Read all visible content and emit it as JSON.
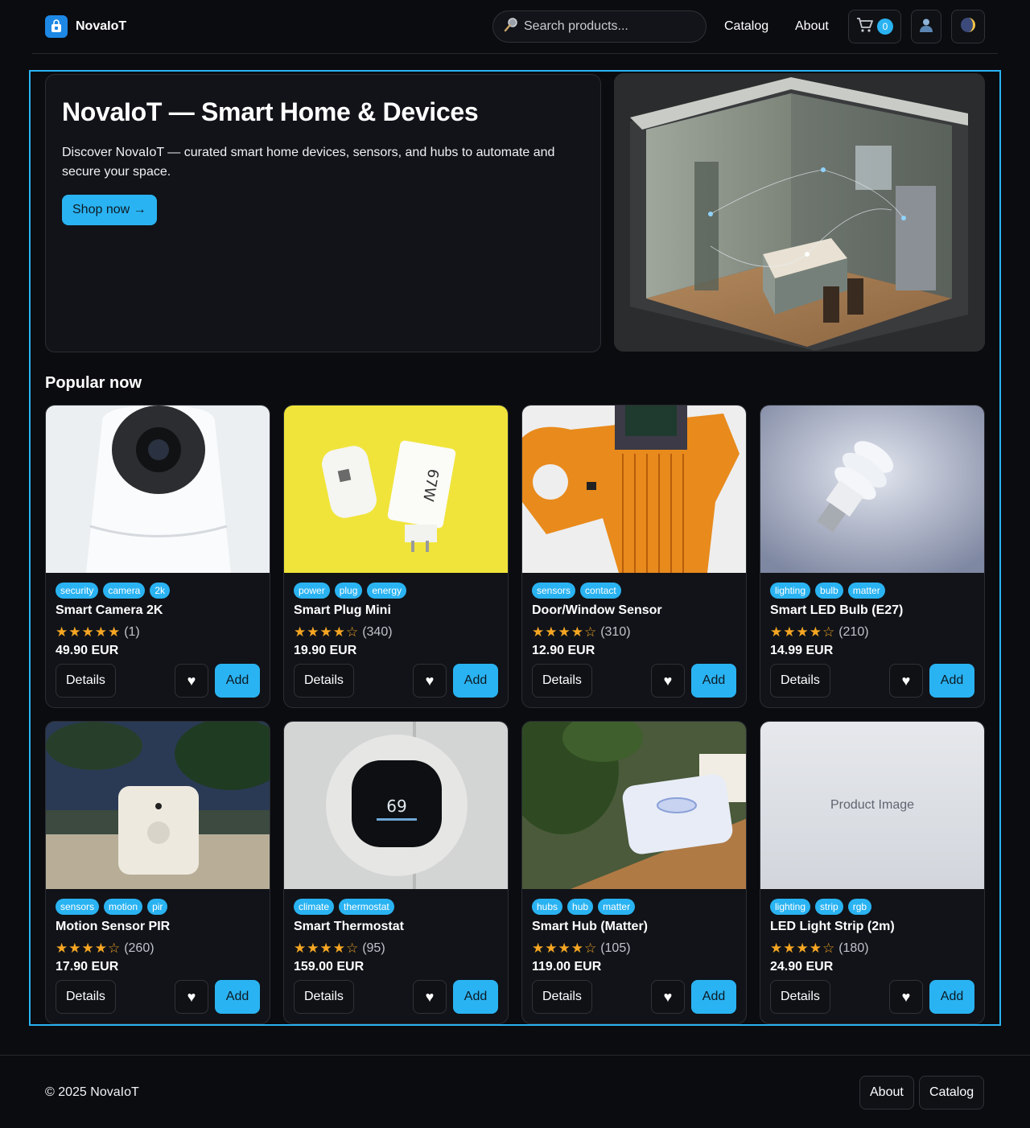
{
  "header": {
    "brand": "NovaIoT",
    "search_placeholder": "Search products...",
    "nav": [
      "Catalog",
      "About"
    ],
    "cart_count": "0"
  },
  "hero": {
    "title": "NovaIoT — Smart Home & Devices",
    "text": "Discover NovaIoT — curated smart home devices, sensors, and hubs to automate and secure your space.",
    "cta": "Shop now →"
  },
  "section_title": "Popular now",
  "products": [
    {
      "tags": [
        "security",
        "camera",
        "2k"
      ],
      "name": "Smart Camera 2K",
      "stars": "★★★★★",
      "count": "(1)",
      "price": "49.90 EUR"
    },
    {
      "tags": [
        "power",
        "plug",
        "energy"
      ],
      "name": "Smart Plug Mini",
      "stars": "★★★★☆",
      "count": "(340)",
      "price": "19.90 EUR"
    },
    {
      "tags": [
        "sensors",
        "contact"
      ],
      "name": "Door/Window Sensor",
      "stars": "★★★★☆",
      "count": "(310)",
      "price": "12.90 EUR"
    },
    {
      "tags": [
        "lighting",
        "bulb",
        "matter"
      ],
      "name": "Smart LED Bulb (E27)",
      "stars": "★★★★☆",
      "count": "(210)",
      "price": "14.99 EUR"
    },
    {
      "tags": [
        "sensors",
        "motion",
        "pir"
      ],
      "name": "Motion Sensor PIR",
      "stars": "★★★★☆",
      "count": "(260)",
      "price": "17.90 EUR"
    },
    {
      "tags": [
        "climate",
        "thermostat"
      ],
      "name": "Smart Thermostat",
      "stars": "★★★★☆",
      "count": "(95)",
      "price": "159.00 EUR"
    },
    {
      "tags": [
        "hubs",
        "hub",
        "matter"
      ],
      "name": "Smart Hub (Matter)",
      "stars": "★★★★☆",
      "count": "(105)",
      "price": "119.00 EUR"
    },
    {
      "tags": [
        "lighting",
        "strip",
        "rgb"
      ],
      "name": "LED Light Strip (2m)",
      "stars": "★★★★☆",
      "count": "(180)",
      "price": "24.90 EUR"
    }
  ],
  "buttons": {
    "details": "Details",
    "add": "Add",
    "heart": "♥"
  },
  "placeholder_image_text": "Product Image",
  "thermostat_display": "69",
  "plug_label": "67W",
  "footer": {
    "copyright": "© 2025 NovaIoT",
    "links": [
      "About",
      "Catalog"
    ]
  },
  "colors": {
    "accent": "#2ab3f2",
    "background": "#0b0c10",
    "card": "#111318",
    "star": "#f6a623"
  },
  "icons": {
    "logo": "bag-icon",
    "search": "magnifier-icon",
    "cart": "cart-icon",
    "user": "user-icon",
    "theme": "moon-icon",
    "favorite": "heart-icon"
  }
}
